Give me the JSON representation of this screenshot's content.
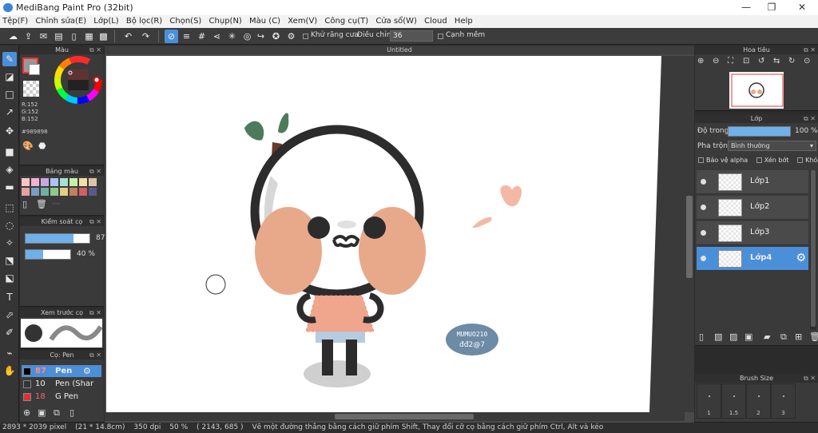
{
  "app": {
    "title": "MediBang Paint Pro (32bit)"
  },
  "window_controls": {
    "minimize": "—",
    "maximize": "❐",
    "close": "✕"
  },
  "menu": [
    "Tệp(F)",
    "Chỉnh sửa(E)",
    "Lớp(L)",
    "Bộ lọc(R)",
    "Chọn(S)",
    "Chụp(N)",
    "Màu (C)",
    "Xem(V)",
    "Công cụ(T)",
    "Cửa sổ(W)",
    "Cloud",
    "Help"
  ],
  "toolbar": {
    "antialias_label": "Khử răng cưa",
    "adjust_label": "Điều chỉnh",
    "adjust_value": "36",
    "edge_label": "Cạnh mềm"
  },
  "color_panel": {
    "title": "Màu",
    "r": "R:152",
    "g": "G:152",
    "b": "B:152",
    "hex": "#989898"
  },
  "palette_panel": {
    "title": "Bảng màu",
    "more": "····"
  },
  "brush_control": {
    "title": "Kiểm soát cọ",
    "size": "87",
    "opacity": "40 %",
    "opacity_fraction": 0.4
  },
  "brush_preview": {
    "title": "Xem trước cọ"
  },
  "brush_panel": {
    "title": "Cọ: Pen",
    "brushes": [
      {
        "size": "87",
        "name": "Pen",
        "selected": true,
        "color": "#000000"
      },
      {
        "size": "10",
        "name": "Pen (Shar",
        "selected": false,
        "color": "#333333"
      },
      {
        "size": "18",
        "name": "G Pen",
        "selected": false,
        "color": "#e23030"
      }
    ]
  },
  "canvas": {
    "tab": "Untitled",
    "sign_line1": "MUMUO210",
    "sign_line2": "đđ2@7"
  },
  "navigator": {
    "title": "Hoa tiêu"
  },
  "layer_panel": {
    "title": "Lớp",
    "opacity_label": "Độ trong",
    "opacity_value": "100 %",
    "blend_label": "Pha trộn",
    "blend_value": "Bình thường",
    "protect_alpha": "Bảo vệ alpha",
    "clipping": "Xén bớt",
    "lock": "Khóa",
    "layers": [
      {
        "name": "Lớp1",
        "selected": false
      },
      {
        "name": "Lớp2",
        "selected": false
      },
      {
        "name": "Lớp3",
        "selected": false
      },
      {
        "name": "Lớp4",
        "selected": true
      }
    ]
  },
  "brush_size": {
    "title": "Brush Size",
    "sizes": [
      "1",
      "1.5",
      "2",
      "3"
    ]
  },
  "status": {
    "size": "2893 * 2039 pixel",
    "cm": "(21 * 14.8cm)",
    "dpi": "350 dpi",
    "zoom": "50 %",
    "coords": "( 2143, 685 )",
    "hint": "Vẽ một đường thẳng bằng cách giữ phím Shift, Thay đổi cỡ cọ bằng cách giữ phím Ctrl, Alt và kéo"
  }
}
